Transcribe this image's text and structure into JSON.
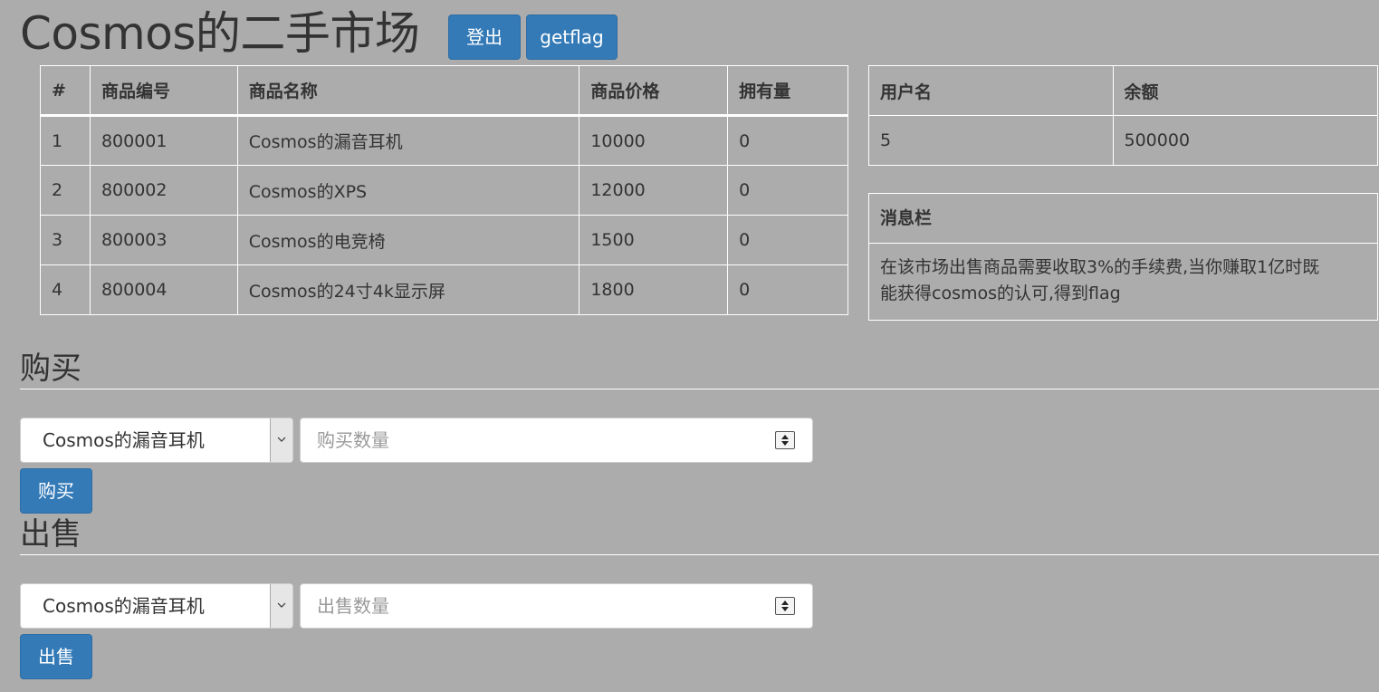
{
  "header": {
    "title": "Cosmos的二手市场",
    "logout_label": "登出",
    "getflag_label": "getflag"
  },
  "goods_table": {
    "columns": [
      "#",
      "商品编号",
      "商品名称",
      "商品价格",
      "拥有量"
    ],
    "rows": [
      [
        "1",
        "800001",
        "Cosmos的漏音耳机",
        "10000",
        "0"
      ],
      [
        "2",
        "800002",
        "Cosmos的XPS",
        "12000",
        "0"
      ],
      [
        "3",
        "800003",
        "Cosmos的电竞椅",
        "1500",
        "0"
      ],
      [
        "4",
        "800004",
        "Cosmos的24寸4k显示屏",
        "1800",
        "0"
      ]
    ]
  },
  "user_table": {
    "columns": [
      "用户名",
      "余额"
    ],
    "username": "5",
    "balance": "500000"
  },
  "message_box": {
    "title": "消息栏",
    "line1": "在该市场出售商品需要收取3%的手续费,当你赚取1亿时既",
    "line2": "能获得cosmos的认可,得到flag"
  },
  "buy": {
    "title": "购买",
    "selected": "Cosmos的漏音耳机",
    "placeholder": "购买数量",
    "button": "购买"
  },
  "sell": {
    "title": "出售",
    "selected": "Cosmos的漏音耳机",
    "placeholder": "出售数量",
    "button": "出售"
  },
  "colors": {
    "background": "#acacac",
    "primary_button": "#337ab7",
    "text": "#333333"
  },
  "icons": {
    "select_arrow": "chevron-down-icon",
    "number_spinner": "spinner-icon"
  }
}
